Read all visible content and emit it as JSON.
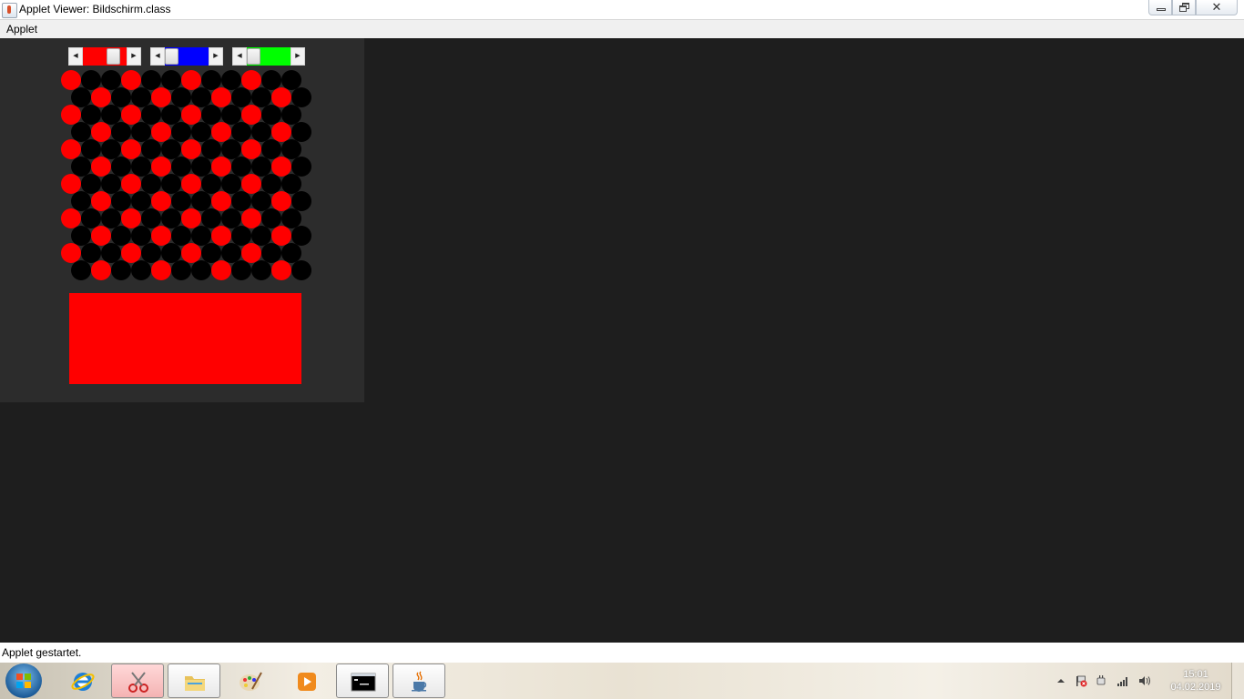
{
  "window": {
    "title": "Applet Viewer: Bildschirm.class",
    "close_glyph": "✕"
  },
  "menubar": {
    "items": [
      {
        "label": "Applet"
      }
    ]
  },
  "applet": {
    "scrollbars": [
      {
        "name": "red",
        "color": "#ff0000",
        "value_fraction": 0.79
      },
      {
        "name": "blue",
        "color": "#0000ff",
        "value_fraction": 0.0
      },
      {
        "name": "green",
        "color": "#00ff00",
        "value_fraction": 0.0
      }
    ],
    "arrow_left": "◀",
    "arrow_right": "▶",
    "circle_grid": {
      "rows": 12,
      "cols": 12,
      "base_color": "#000000",
      "highlight_color": "#ff0000",
      "highlight_pattern": [
        [
          0,
          3,
          6,
          9
        ],
        [
          1,
          4,
          7,
          10
        ],
        [
          0,
          3,
          6,
          9
        ],
        [
          1,
          4,
          7,
          10
        ],
        [
          0,
          3,
          6,
          9
        ],
        [
          1,
          4,
          7,
          10
        ],
        [
          0,
          3,
          6,
          9
        ],
        [
          1,
          4,
          7,
          10
        ],
        [
          0,
          3,
          6,
          9
        ],
        [
          1,
          4,
          7,
          10
        ],
        [
          0,
          3,
          6,
          9
        ],
        [
          1,
          4,
          7,
          10
        ]
      ]
    },
    "swatch_color": "#ff0000"
  },
  "status": {
    "text": "Applet gestartet."
  },
  "taskbar": {
    "items": [
      {
        "name": "internet-explorer",
        "icon": "ie-icon",
        "state": "pinned"
      },
      {
        "name": "snipping-tool",
        "icon": "scissors-icon",
        "state": "active"
      },
      {
        "name": "windows-explorer",
        "icon": "folder-icon",
        "state": "running"
      },
      {
        "name": "paint",
        "icon": "palette-icon",
        "state": "pinned"
      },
      {
        "name": "media-player",
        "icon": "media-player-icon",
        "state": "pinned"
      },
      {
        "name": "command-prompt",
        "icon": "console-icon",
        "state": "running"
      },
      {
        "name": "java",
        "icon": "java-cup-icon",
        "state": "running"
      }
    ],
    "clock": {
      "time": "15:01",
      "date": "04.02.2019"
    }
  }
}
